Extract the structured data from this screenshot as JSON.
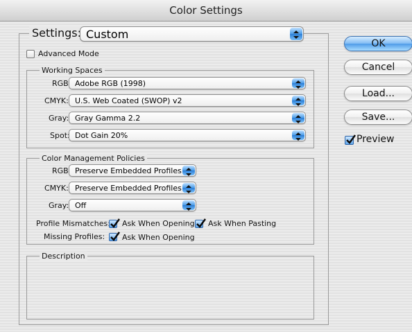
{
  "window": {
    "title": "Color Settings"
  },
  "settings": {
    "label": "Settings:",
    "value": "Custom"
  },
  "advanced_mode": {
    "label": "Advanced Mode",
    "checked": false
  },
  "working_spaces": {
    "legend": "Working Spaces",
    "rows": [
      {
        "label": "RGB:",
        "value": "Adobe RGB (1998)"
      },
      {
        "label": "CMYK:",
        "value": "U.S. Web Coated (SWOP) v2"
      },
      {
        "label": "Gray:",
        "value": "Gray Gamma 2.2"
      },
      {
        "label": "Spot:",
        "value": "Dot Gain 20%"
      }
    ]
  },
  "policies": {
    "legend": "Color Management Policies",
    "rows": [
      {
        "label": "RGB:",
        "value": "Preserve Embedded Profiles"
      },
      {
        "label": "CMYK:",
        "value": "Preserve Embedded Profiles"
      },
      {
        "label": "Gray:",
        "value": "Off"
      }
    ],
    "profile_mismatches": {
      "label": "Profile Mismatches:",
      "ask_opening": "Ask When Opening",
      "ask_pasting": "Ask When Pasting"
    },
    "missing_profiles": {
      "label": "Missing Profiles:",
      "ask_opening": "Ask When Opening"
    }
  },
  "description": {
    "legend": "Description"
  },
  "buttons": {
    "ok": "OK",
    "cancel": "Cancel",
    "load": "Load...",
    "save": "Save..."
  },
  "preview": {
    "label": "Preview",
    "checked": true
  },
  "colors": {
    "accent": "#4f9be8",
    "title_bar": "#dcdcdc"
  }
}
